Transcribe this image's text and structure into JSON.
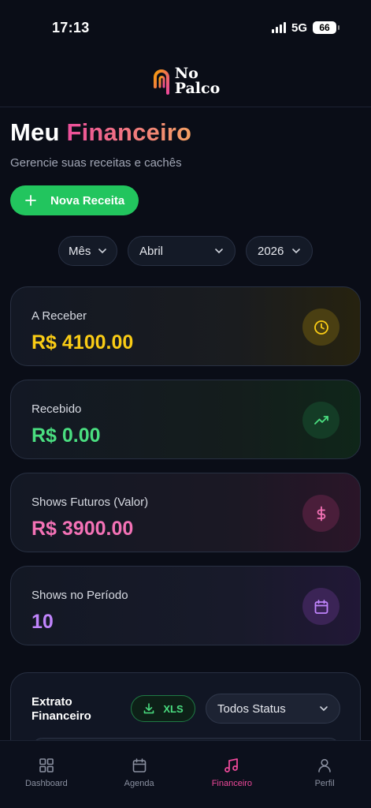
{
  "status_bar": {
    "time": "17:13",
    "network": "5G",
    "battery": "66"
  },
  "header": {
    "logo_line1": "No",
    "logo_line2": "Palco"
  },
  "page": {
    "title_main": "Meu",
    "title_accent": "Financeiro",
    "subtitle": "Gerencie suas receitas e cachês",
    "new_button_label": "Nova Receita"
  },
  "filters": {
    "period": "Mês",
    "month": "Abril",
    "year": "2026"
  },
  "cards": [
    {
      "label": "A Receber",
      "value": "R$ 4100.00",
      "icon": "clock-icon",
      "color": "#facc15"
    },
    {
      "label": "Recebido",
      "value": "R$ 0.00",
      "icon": "trending-up-icon",
      "color": "#4ade80"
    },
    {
      "label": "Shows Futuros (Valor)",
      "value": "R$ 3900.00",
      "icon": "dollar-icon",
      "color": "#f472b6"
    },
    {
      "label": "Shows no Período",
      "value": "10",
      "icon": "calendar-icon",
      "color": "#c084fc"
    }
  ],
  "extrato": {
    "title": "Extrato Financeiro",
    "export_label": "XLS",
    "status_filter": "Todos Status"
  },
  "nav": [
    {
      "label": "Dashboard",
      "icon": "dashboard-icon",
      "active": false
    },
    {
      "label": "Agenda",
      "icon": "calendar-icon",
      "active": false
    },
    {
      "label": "Financeiro",
      "icon": "music-icon",
      "active": true
    },
    {
      "label": "Perfil",
      "icon": "user-icon",
      "active": false
    }
  ]
}
